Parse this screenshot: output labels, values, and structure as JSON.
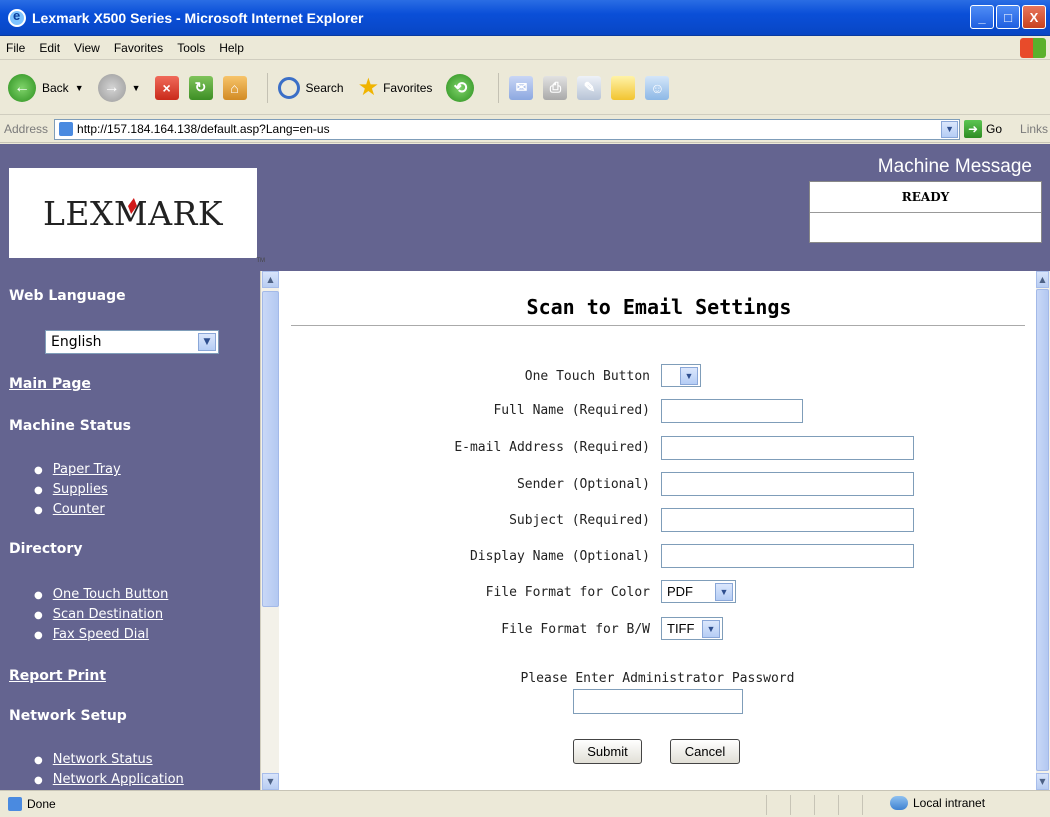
{
  "window": {
    "title": "Lexmark X500 Series - Microsoft Internet Explorer",
    "minimize": "_",
    "maximize": "□",
    "close": "X"
  },
  "menu": [
    "File",
    "Edit",
    "View",
    "Favorites",
    "Tools",
    "Help"
  ],
  "toolbar": {
    "back": "Back",
    "search": "Search",
    "favorites": "Favorites"
  },
  "address": {
    "label": "Address",
    "url": "http://157.184.164.138/default.asp?Lang=en-us",
    "go": "Go",
    "links": "Links"
  },
  "header": {
    "logo": "LEXMARK",
    "machine_message_title": "Machine Message",
    "machine_message": "READY"
  },
  "sidebar": {
    "web_language_heading": "Web Language",
    "language_value": "English",
    "main_page": "Main Page",
    "machine_status_heading": "Machine Status",
    "machine_status_items": [
      "Paper Tray",
      "Supplies",
      "Counter"
    ],
    "directory_heading": "Directory",
    "directory_items": [
      "One Touch Button",
      "Scan Destination",
      "Fax Speed Dial"
    ],
    "report_print": "Report Print",
    "network_setup_heading": "Network Setup",
    "network_items": [
      "Network Status",
      "Network Application"
    ]
  },
  "form": {
    "title": "Scan to Email Settings",
    "one_touch_label": "One Touch Button",
    "one_touch_value": "",
    "full_name_label": "Full Name (Required)",
    "email_label": "E-mail Address (Required)",
    "sender_label": "Sender (Optional)",
    "subject_label": "Subject (Required)",
    "display_name_label": "Display Name (Optional)",
    "color_format_label": "File Format for Color",
    "color_format_value": "PDF",
    "bw_format_label": "File Format for B/W",
    "bw_format_value": "TIFF",
    "password_prompt": "Please Enter Administrator Password",
    "submit": "Submit",
    "cancel": "Cancel"
  },
  "status": {
    "text": "Done",
    "zone": "Local intranet"
  },
  "colors": {
    "header_bg": "#646490",
    "titlebar": "#0a4fd8"
  }
}
